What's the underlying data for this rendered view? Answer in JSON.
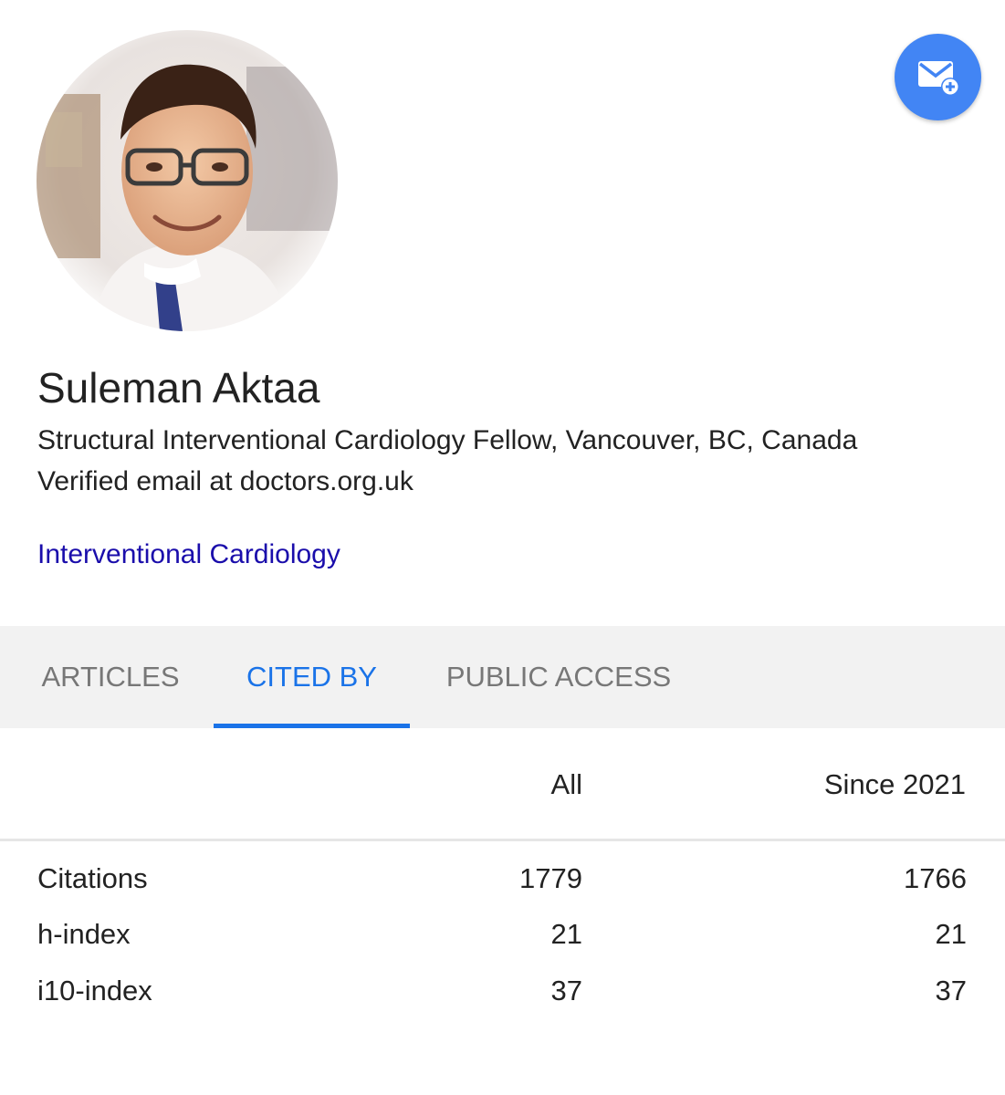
{
  "profile": {
    "name": "Suleman Aktaa",
    "affiliation": "Structural Interventional Cardiology Fellow, Vancouver, BC, Canada",
    "email": "Verified email at doctors.org.uk",
    "interests": [
      "Interventional Cardiology"
    ],
    "photo_icon": "profile-photo",
    "follow_icon": "email-add-icon"
  },
  "tabs": [
    {
      "label": "ARTICLES",
      "active": false
    },
    {
      "label": "CITED BY",
      "active": true
    },
    {
      "label": "PUBLIC ACCESS",
      "active": false
    }
  ],
  "stats": {
    "columns": [
      "All",
      "Since 2021"
    ],
    "rows": [
      {
        "label": "Citations",
        "all": "1779",
        "since": "1766"
      },
      {
        "label": "h-index",
        "all": "21",
        "since": "21"
      },
      {
        "label": "i10-index",
        "all": "37",
        "since": "37"
      }
    ]
  },
  "colors": {
    "accent": "#1a73e8",
    "fab": "#4285f4",
    "link": "#1a0dab",
    "tabbar_bg": "#f2f2f2"
  }
}
